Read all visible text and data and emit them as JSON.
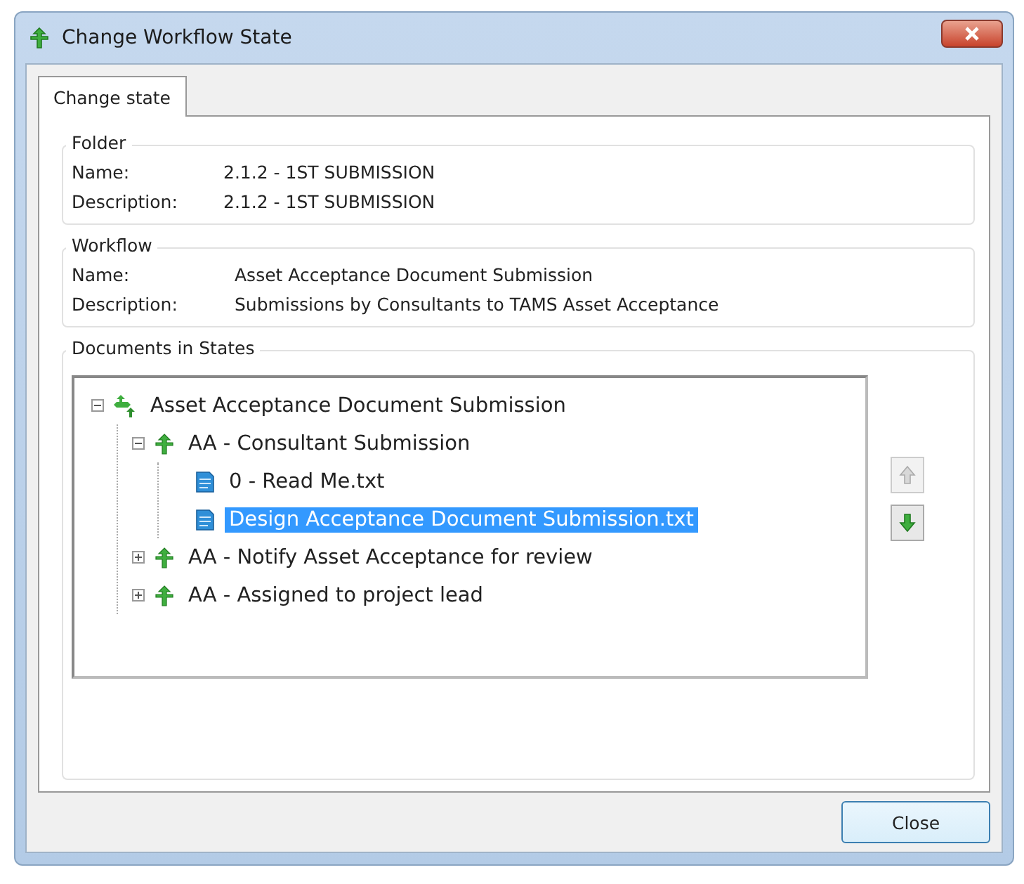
{
  "window": {
    "title": "Change Workflow State"
  },
  "tabs": [
    {
      "label": "Change state",
      "selected": true
    }
  ],
  "folder": {
    "title": "Folder",
    "fields": [
      {
        "label": "Name:",
        "value": "2.1.2 - 1ST SUBMISSION"
      },
      {
        "label": "Description:",
        "value": "2.1.2 - 1ST SUBMISSION"
      }
    ]
  },
  "workflow": {
    "title": "Workflow",
    "fields": [
      {
        "label": "Name:",
        "value": "Asset Acceptance Document Submission"
      },
      {
        "label": "Description:",
        "value": "Submissions by Consultants to TAMS Asset Acceptance"
      }
    ]
  },
  "documents_in_states": {
    "title": "Documents in States",
    "tree": [
      {
        "label": "Asset Acceptance Document Submission",
        "kind": "workflow",
        "expanded": true,
        "selected": false,
        "children": [
          {
            "label": "AA - Consultant Submission",
            "kind": "state",
            "expanded": true,
            "selected": false,
            "children": [
              {
                "label": "0 - Read Me.txt",
                "kind": "document",
                "selected": false
              },
              {
                "label": "Design Acceptance Document Submission.txt",
                "kind": "document",
                "selected": true
              }
            ]
          },
          {
            "label": "AA - Notify Asset Acceptance for review",
            "kind": "state",
            "expanded": false,
            "selected": false
          },
          {
            "label": "AA - Assigned to project lead",
            "kind": "state",
            "expanded": false,
            "selected": false
          }
        ]
      }
    ],
    "side_buttons": [
      {
        "kind": "up",
        "disabled": true
      },
      {
        "kind": "down",
        "disabled": false
      }
    ]
  },
  "buttons": [
    {
      "label": "Close"
    }
  ]
}
